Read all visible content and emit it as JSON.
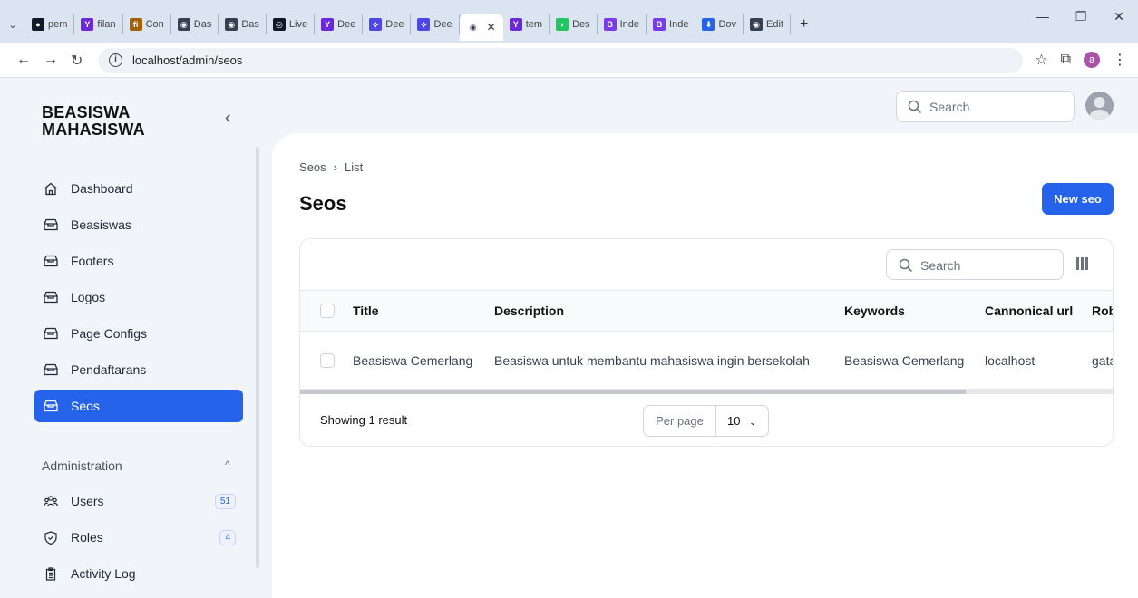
{
  "browser": {
    "tabs": [
      {
        "label": "pem",
        "color": "#111827",
        "glyph": "●"
      },
      {
        "label": "filan",
        "color": "#6d28d9",
        "glyph": "Y"
      },
      {
        "label": "Con",
        "color": "#a16207",
        "glyph": "fi"
      },
      {
        "label": "Das",
        "color": "#374151",
        "glyph": "◉"
      },
      {
        "label": "Das",
        "color": "#374151",
        "glyph": "◉"
      },
      {
        "label": "Live",
        "color": "#111827",
        "glyph": "◎"
      },
      {
        "label": "Dee",
        "color": "#6d28d9",
        "glyph": "Y"
      },
      {
        "label": "Dee",
        "color": "#4f46e5",
        "glyph": "⟡"
      },
      {
        "label": "Dee",
        "color": "#4f46e5",
        "glyph": "⟡"
      }
    ],
    "active_tab": {
      "label": "",
      "color": "#374151",
      "glyph": "◉"
    },
    "tabs_after": [
      {
        "label": "tem",
        "color": "#6d28d9",
        "glyph": "Y"
      },
      {
        "label": "Des",
        "color": "#22c55e",
        "glyph": "◗"
      },
      {
        "label": "Inde",
        "color": "#7c3aed",
        "glyph": "B"
      },
      {
        "label": "Inde",
        "color": "#7c3aed",
        "glyph": "B"
      },
      {
        "label": "Dov",
        "color": "#2563eb",
        "glyph": "⬇"
      },
      {
        "label": "Edit",
        "color": "#374151",
        "glyph": "◉"
      }
    ],
    "url": "localhost/admin/seos",
    "profile_initial": "a"
  },
  "sidebar": {
    "brand_line1": "BEASISWA",
    "brand_line2": "MAHASISWA",
    "items": [
      {
        "label": "Dashboard",
        "icon": "home-icon"
      },
      {
        "label": "Beasiswas",
        "icon": "box-icon"
      },
      {
        "label": "Footers",
        "icon": "box-icon"
      },
      {
        "label": "Logos",
        "icon": "box-icon"
      },
      {
        "label": "Page Configs",
        "icon": "box-icon"
      },
      {
        "label": "Pendaftarans",
        "icon": "box-icon"
      },
      {
        "label": "Seos",
        "icon": "box-icon",
        "active": true
      }
    ],
    "group_label": "Administration",
    "admin_items": [
      {
        "label": "Users",
        "icon": "users-icon",
        "badge": "51"
      },
      {
        "label": "Roles",
        "icon": "shield-icon",
        "badge": "4"
      },
      {
        "label": "Activity Log",
        "icon": "clipboard-icon",
        "badge": ""
      }
    ]
  },
  "topbar": {
    "search_placeholder": "Search"
  },
  "page": {
    "breadcrumb": [
      "Seos",
      "List"
    ],
    "title": "Seos",
    "new_button": "New seo"
  },
  "table": {
    "search_placeholder": "Search",
    "columns": [
      "Title",
      "Description",
      "Keywords",
      "Cannonical url",
      "Rob"
    ],
    "rows": [
      [
        "Beasiswa Cemerlang",
        "Beasiswa untuk membantu mahasiswa ingin bersekolah",
        "Beasiswa Cemerlang",
        "localhost",
        "gata"
      ]
    ],
    "showing": "Showing 1 result",
    "per_page_label": "Per page",
    "per_page_value": "10"
  },
  "colors": {
    "accent": "#2563eb"
  }
}
